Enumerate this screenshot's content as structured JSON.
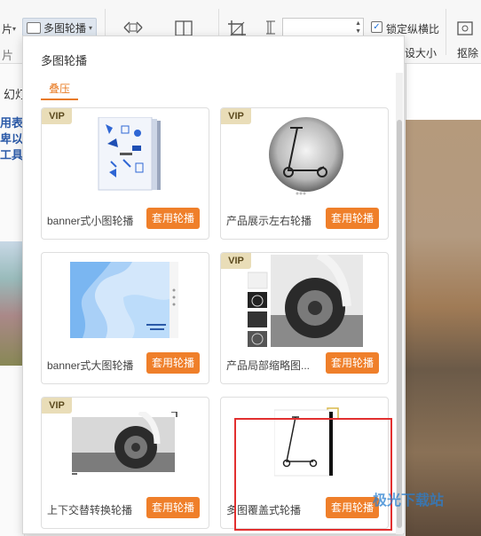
{
  "toolbar": {
    "left_partial_label": "片",
    "multi_carousel_label": "多图轮播",
    "lock_ratio_label": "锁定纵横比",
    "resize_label": "设大小",
    "cutout_label": "抠除",
    "lock_ratio_checked": true
  },
  "background": {
    "left_labels": [
      "片",
      "幻灯",
      "用表",
      "卑以",
      "工具"
    ]
  },
  "panel": {
    "title": "多图轮播",
    "tab": "叠压",
    "cards": [
      {
        "label": "banner式小图轮播",
        "button": "套用轮播",
        "vip": "VIP"
      },
      {
        "label": "产品展示左右轮播",
        "button": "套用轮播",
        "vip": "VIP"
      },
      {
        "label": "banner式大图轮播",
        "button": "套用轮播",
        "vip": ""
      },
      {
        "label": "产品局部缩略图...",
        "button": "套用轮播",
        "vip": "VIP"
      },
      {
        "label": "上下交替转换轮播",
        "button": "套用轮播",
        "vip": "VIP"
      },
      {
        "label": "多图覆盖式轮播",
        "button": "套用轮播",
        "vip": ""
      }
    ]
  },
  "watermark": "极光下载站",
  "colors": {
    "accent": "#ef7f2a",
    "vip_bg": "#e9ddb8",
    "highlight": "#e23030"
  }
}
